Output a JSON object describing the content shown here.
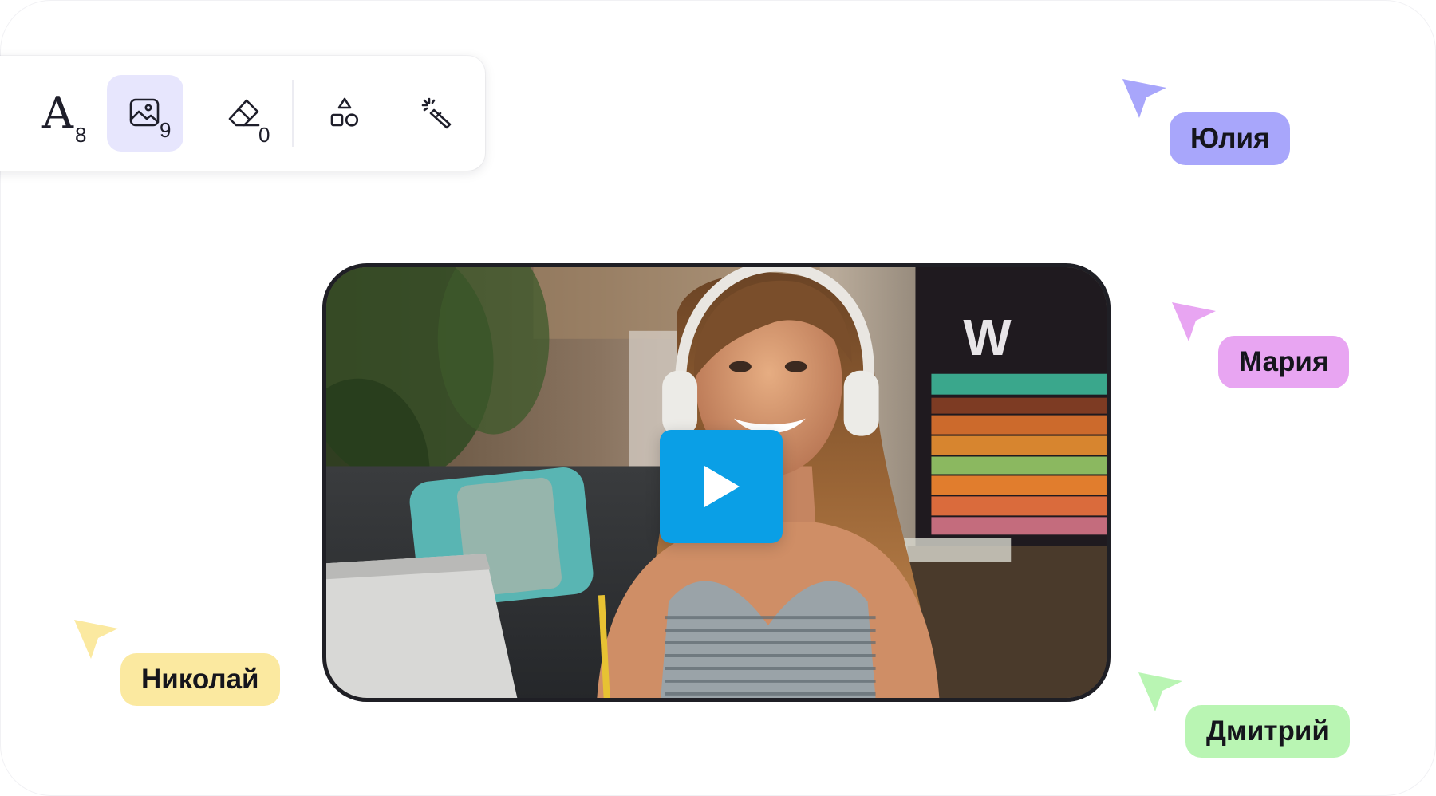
{
  "toolbar": {
    "tools": [
      {
        "name": "text-tool",
        "icon": "text-icon",
        "glyph": "A",
        "count": "8",
        "active": false
      },
      {
        "name": "image-tool",
        "icon": "image-icon",
        "count": "9",
        "active": true
      },
      {
        "name": "eraser-tool",
        "icon": "eraser-icon",
        "count": "0",
        "active": false
      },
      {
        "name": "shapes-tool",
        "icon": "shapes-icon",
        "active": false
      },
      {
        "name": "magic-wand-tool",
        "icon": "magic-wand-icon",
        "active": false
      }
    ],
    "active_color": "#e7e6fd"
  },
  "video": {
    "play_icon": "play-icon",
    "play_color": "#0a9fe6"
  },
  "collaborators": [
    {
      "name": "Юлия",
      "color": "#a8a6fb"
    },
    {
      "name": "Мария",
      "color": "#e8a5f2"
    },
    {
      "name": "Николай",
      "color": "#fbe9a0"
    },
    {
      "name": "Дмитрий",
      "color": "#b9f5b3"
    }
  ]
}
